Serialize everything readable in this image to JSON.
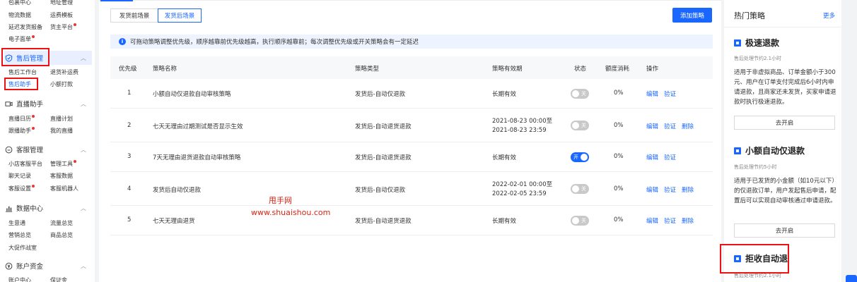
{
  "sidebar": {
    "top_rows": [
      {
        "a": "包裹中心",
        "b": "地址管理",
        "a_dot": false,
        "b_dot": false
      },
      {
        "a": "物流数据",
        "b": "运费模板",
        "a_dot": false,
        "b_dot": false
      },
      {
        "a": "延迟发货报备",
        "b": "货主平台",
        "a_dot": false,
        "b_dot": true
      },
      {
        "a": "电子面单",
        "b": "",
        "a_dot": true,
        "b_dot": false
      }
    ],
    "aftersale_title": "售后管理",
    "aftersale_rows": [
      {
        "a": "售后工作台",
        "b": "退货补运费"
      },
      {
        "a": "售后助手",
        "b": "小额打款"
      }
    ],
    "live_title": "直播助手",
    "live_rows": [
      {
        "a": "直播日历",
        "b": "直播计划",
        "a_dot": true
      },
      {
        "a": "跟播助手",
        "b": "我的直播",
        "a_dot": true
      }
    ],
    "cs_title": "客服管理",
    "cs_rows": [
      {
        "a": "小店客服平台",
        "b": "管理工具",
        "b_dot": true
      },
      {
        "a": "聊天记录",
        "b": "客服数据"
      },
      {
        "a": "客服设置",
        "b": "客服机器人",
        "a_dot": true
      }
    ],
    "data_title": "数据中心",
    "data_rows": [
      {
        "a": "生意通",
        "b": "流量总览"
      },
      {
        "a": "营销总览",
        "b": "商品总览"
      },
      {
        "a": "大促作战室",
        "b": ""
      }
    ],
    "fund_title": "账户资金",
    "fund_rows": [
      {
        "a": "账户中心",
        "b": "保证金"
      }
    ]
  },
  "main": {
    "tabs": [
      "发货前场景",
      "发货后场景"
    ],
    "add_button": "添加策略",
    "notice": "可拖动策略调整优先级，顺序越靠前优先级越高，执行顺序越靠前；每次调整优先级或开关策略会有一定延迟",
    "columns": [
      "优先级",
      "策略名称",
      "策略类型",
      "策略有效期",
      "状态",
      "额度消耗",
      "操作"
    ],
    "rows": [
      {
        "priority": "1",
        "name": "小额自动仅退款自动审核策略",
        "type": "发货后-自动仅退款",
        "validity": [
          "长期有效"
        ],
        "status_label": "关",
        "on": false,
        "usage": "0%",
        "ops": [
          "编辑",
          "验证"
        ]
      },
      {
        "priority": "2",
        "name": "七天无理由过期测试是否显示生效",
        "type": "发货后-自动退货退款",
        "validity": [
          "2021-08-23 00:00至",
          "2021-08-23 23:59"
        ],
        "status_label": "关",
        "on": false,
        "usage": "0%",
        "ops": [
          "编辑",
          "验证",
          "删除"
        ]
      },
      {
        "priority": "3",
        "name": "7天无理由退货退款自动审核策略",
        "type": "发货后-自动退货退款",
        "validity": [
          "长期有效"
        ],
        "status_label": "开",
        "on": true,
        "usage": "0%",
        "ops": [
          "编辑",
          "验证"
        ]
      },
      {
        "priority": "4",
        "name": "发货后自动仅退款",
        "type": "发货后-自动仅退款",
        "validity": [
          "2022-02-01 00:00至",
          "2022-02-05 23:59"
        ],
        "status_label": "关",
        "on": false,
        "usage": "0%",
        "ops": [
          "编辑",
          "验证",
          "删除"
        ]
      },
      {
        "priority": "5",
        "name": "七天无理由退货",
        "type": "发货后-自动退货退款",
        "validity": [
          "长期有效"
        ],
        "status_label": "关",
        "on": false,
        "usage": "0%",
        "ops": [
          "编辑",
          "验证",
          "删除"
        ]
      }
    ],
    "watermark": [
      "甩手网",
      "www.shuaishou.com"
    ]
  },
  "right": {
    "title": "热门策略",
    "more": "更多",
    "cards": [
      {
        "title": "极速退款",
        "sub": "售后处理节约2.1小时",
        "desc": "适用于非虚拟商品、订单金额小于300元、用户在订单支付完成后6小时内申请退款，且商家还未发货，买家申请退款时执行极速退款。",
        "button": "去开启"
      },
      {
        "title": "小额自动仅退款",
        "sub": "售后处理节约5小时",
        "desc": "适用于已发货的小金额（如10元以下）的仅退款订单，用户发起售后申请，配置后可以实现自动审核通过申请退款。",
        "button": "去开启"
      },
      {
        "title": "拒收自动退",
        "sub": "售后处理节约2.1小时",
        "desc": "",
        "button": ""
      }
    ]
  },
  "colors": {
    "accent": "#1967ff",
    "highlight": "#e11111"
  }
}
